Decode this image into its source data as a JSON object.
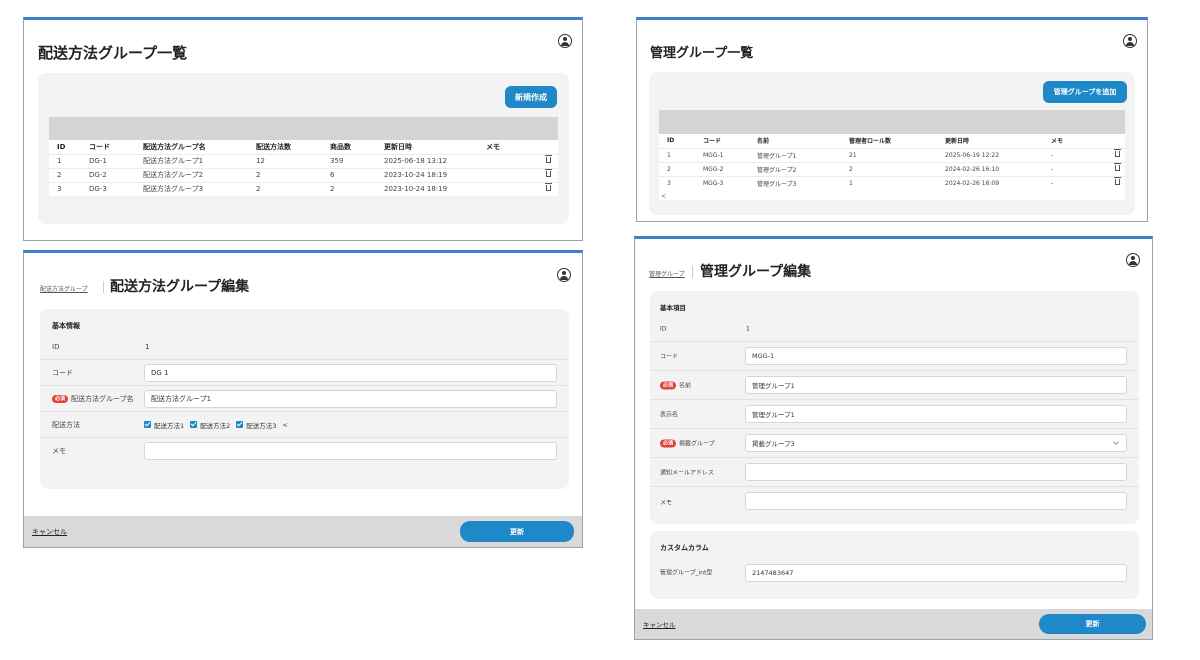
{
  "list1": {
    "title": "配送方法グループ一覧",
    "new_button": "新規作成",
    "columns": [
      "ID",
      "コード",
      "配送方法グループ名",
      "配送方法数",
      "商品数",
      "更新日時",
      "メモ"
    ],
    "rows": [
      [
        "1",
        "DG-1",
        "配送方法グループ1",
        "12",
        "359",
        "2025-06-18 13:12",
        ""
      ],
      [
        "2",
        "DG-2",
        "配送方法グループ2",
        "2",
        "6",
        "2023-10-24 18:19",
        ""
      ],
      [
        "3",
        "DG-3",
        "配送方法グループ3",
        "2",
        "2",
        "2023-10-24 18:19",
        ""
      ]
    ]
  },
  "list2": {
    "title": "管理グループ一覧",
    "add_button": "管理グループを追加",
    "columns": [
      "ID",
      "コード",
      "名前",
      "管理者ロール数",
      "更新日時",
      "メモ"
    ],
    "rows": [
      [
        "1",
        "MGG-1",
        "管理グループ1",
        "21",
        "2025-06-19 12:22",
        "-"
      ],
      [
        "2",
        "MGG-2",
        "管理グループ2",
        "2",
        "2024-02-26 16:10",
        "-"
      ],
      [
        "3",
        "MGG-3",
        "管理グループ3",
        "1",
        "2024-02-26 16:09",
        "-"
      ]
    ],
    "scroll_hint": "<"
  },
  "edit1": {
    "breadcrumb": "配送方法グループ",
    "title": "配送方法グループ編集",
    "section": "基本情報",
    "id_label": "ID",
    "id_value": "1",
    "code_label": "コード",
    "code_value": "DG 1",
    "required_badge": "必須",
    "name_label": "配送方法グループ名",
    "name_value": "配送方法グループ1",
    "methods_label": "配送方法",
    "methods": [
      "配送方法1",
      "配送方法2",
      "配送方法3"
    ],
    "methods_more": "<",
    "memo_label": "メモ",
    "memo_value": "",
    "cancel": "キャンセル",
    "update": "更新"
  },
  "edit2": {
    "breadcrumb": "管理グループ",
    "title": "管理グループ編集",
    "section": "基本項目",
    "id_label": "ID",
    "id_value": "1",
    "code_label": "コード",
    "code_value": "MGG-1",
    "required_badge": "必須",
    "name_label": "名前",
    "name_value": "管理グループ1",
    "display_label": "表示名",
    "display_value": "管理グループ1",
    "parent_label": "掲載グループ",
    "parent_value": "掲載グループ3",
    "email_label": "通知メールアドレス",
    "email_value": "",
    "memo_label": "メモ",
    "memo_value": "",
    "custom_section": "カスタムカラム",
    "custom_label": "管理グループ_int型",
    "custom_value": "2147483647",
    "cancel": "キャンセル",
    "update": "更新"
  },
  "colors": {
    "accent": "#1e88c8",
    "required": "#e0413a",
    "panel_border": "#3f7ec8"
  }
}
